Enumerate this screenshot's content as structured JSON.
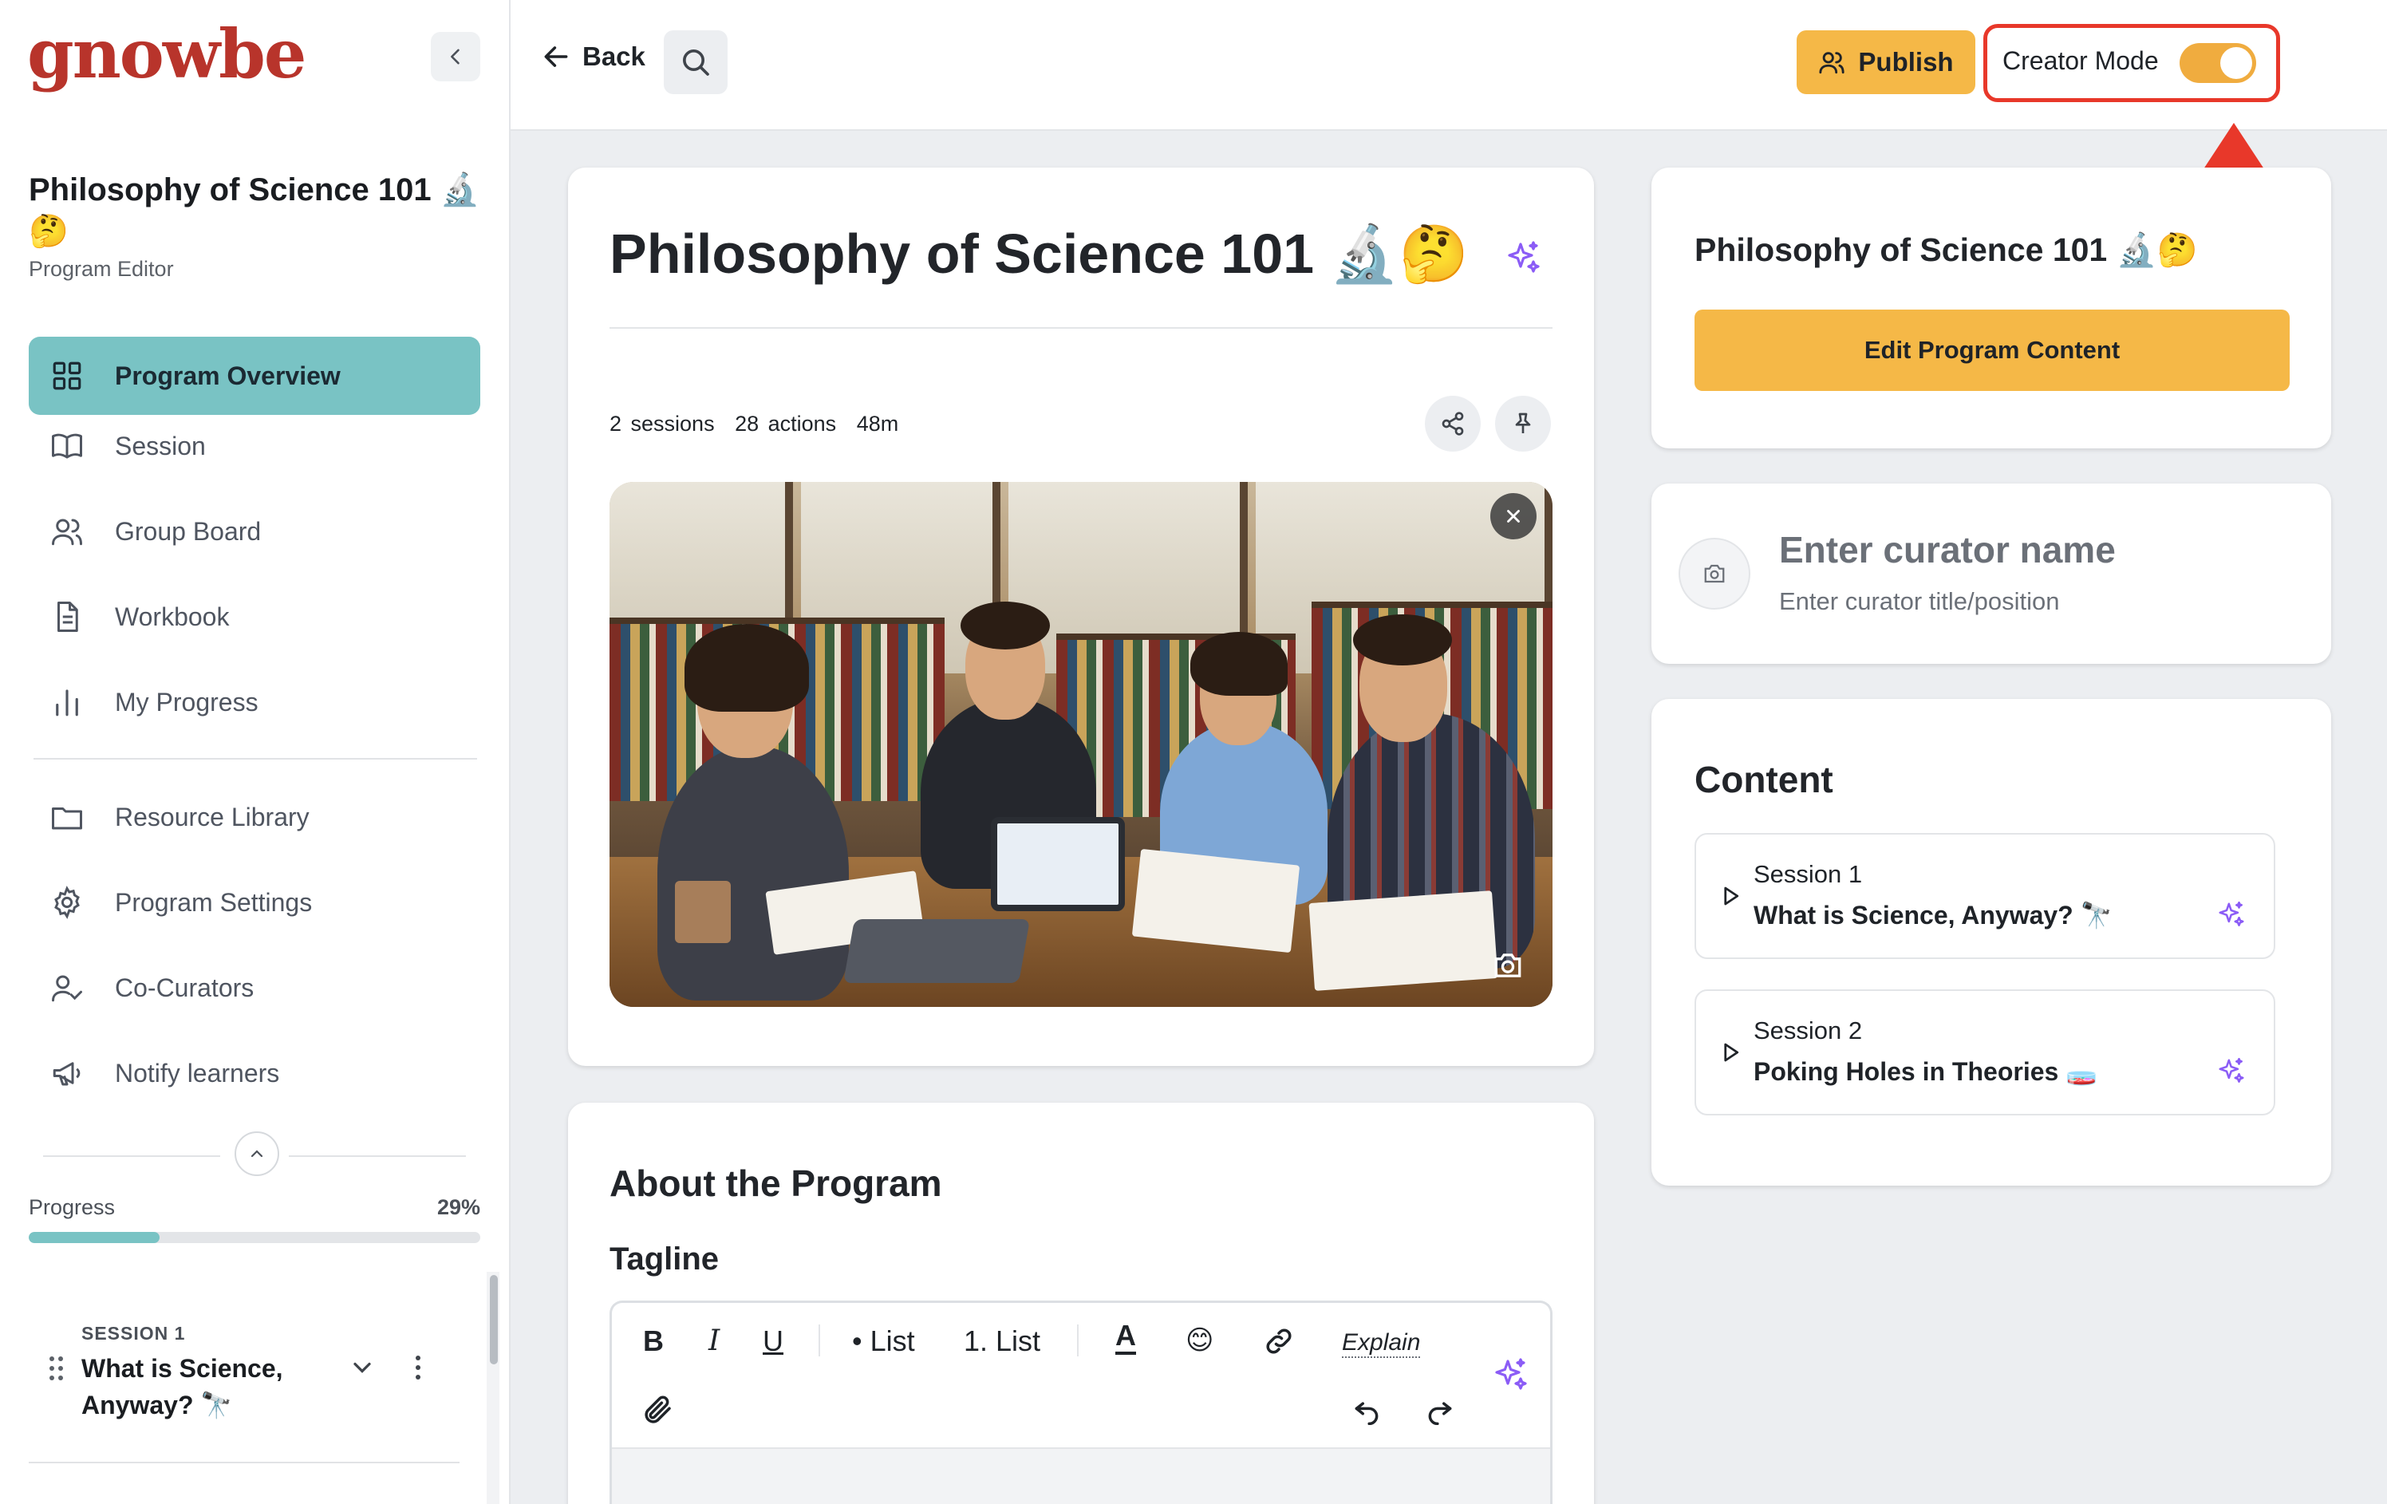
{
  "brand": {
    "logo": "gnowbe",
    "accent": "#79c3c4",
    "cta": "#f5b847",
    "highlight": "#e8382a"
  },
  "sidebar": {
    "program_title": "Philosophy of Science 101 🔬🤔",
    "subtitle": "Program Editor",
    "nav": [
      {
        "label": "Program Overview",
        "icon": "grid-icon",
        "active": true
      },
      {
        "label": "Session",
        "icon": "book-icon"
      },
      {
        "label": "Group Board",
        "icon": "users-icon"
      },
      {
        "label": "Workbook",
        "icon": "document-icon"
      },
      {
        "label": "My Progress",
        "icon": "bar-chart-icon"
      },
      {
        "label": "Resource Library",
        "icon": "folder-icon"
      },
      {
        "label": "Program Settings",
        "icon": "gear-icon"
      },
      {
        "label": "Co-Curators",
        "icon": "user-check-icon"
      },
      {
        "label": "Notify learners",
        "icon": "megaphone-icon"
      }
    ],
    "progress_label": "Progress",
    "progress_pct": "29%",
    "progress_value": 0.29,
    "session_kicker": "SESSION 1",
    "session_name": "What is Science, Anyway? 🔭"
  },
  "topbar": {
    "back_label": "Back",
    "publish_label": "Publish",
    "creator_mode_label": "Creator Mode",
    "creator_mode_on": true
  },
  "overview": {
    "title": "Philosophy of Science 101 🔬🤔",
    "sessions": "2 sessions",
    "actions": "28 actions",
    "duration": "48m",
    "image_alt": "Students studying together in a library",
    "about_title": "About the Program",
    "tagline_title": "Tagline",
    "toolbar": {
      "bold": "B",
      "italic": "I",
      "underline": "U",
      "bullet_list": "• List",
      "numbered_list": "1. List",
      "text_color": "A",
      "emoji": "😊",
      "explain": "Explain"
    }
  },
  "right": {
    "program_title": "Philosophy of Science 101 🔬🤔",
    "edit_button": "Edit Program Content",
    "curator_name_placeholder": "Enter curator name",
    "curator_title_placeholder": "Enter curator title/position",
    "content_title": "Content",
    "sessions": [
      {
        "number": "Session 1",
        "name": "What is Science, Anyway? 🔭"
      },
      {
        "number": "Session 2",
        "name": "Poking Holes in Theories 🧫"
      }
    ]
  }
}
